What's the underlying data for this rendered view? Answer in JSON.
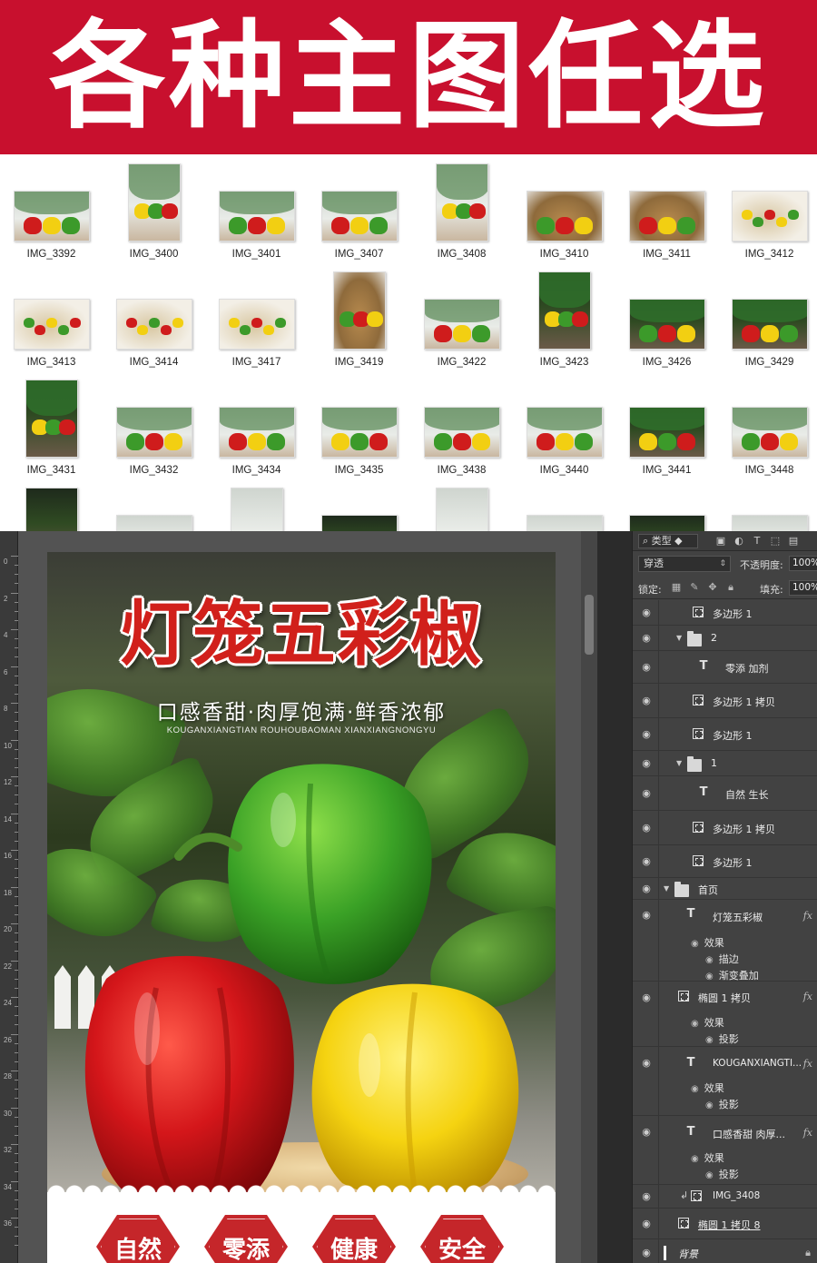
{
  "banner": {
    "title": "各种主图任选",
    "color": "#c8102e"
  },
  "thumbnails": [
    {
      "label": "IMG_3392",
      "shape": "land",
      "bg": "light"
    },
    {
      "label": "IMG_3400",
      "shape": "port",
      "bg": "light"
    },
    {
      "label": "IMG_3401",
      "shape": "land",
      "bg": "light"
    },
    {
      "label": "IMG_3407",
      "shape": "land",
      "bg": "light"
    },
    {
      "label": "IMG_3408",
      "shape": "port",
      "bg": "light"
    },
    {
      "label": "IMG_3410",
      "shape": "land",
      "bg": "basket"
    },
    {
      "label": "IMG_3411",
      "shape": "land",
      "bg": "basket"
    },
    {
      "label": "IMG_3412",
      "shape": "land",
      "bg": "plate"
    },
    {
      "label": "IMG_3413",
      "shape": "land",
      "bg": "plate"
    },
    {
      "label": "IMG_3414",
      "shape": "land",
      "bg": "plate"
    },
    {
      "label": "IMG_3417",
      "shape": "land",
      "bg": "plate"
    },
    {
      "label": "IMG_3419",
      "shape": "port",
      "bg": "basket"
    },
    {
      "label": "IMG_3422",
      "shape": "land",
      "bg": "light"
    },
    {
      "label": "IMG_3423",
      "shape": "port",
      "bg": "dark"
    },
    {
      "label": "IMG_3426",
      "shape": "land",
      "bg": "dark"
    },
    {
      "label": "IMG_3429",
      "shape": "land",
      "bg": "dark"
    },
    {
      "label": "IMG_3431",
      "shape": "port",
      "bg": "dark"
    },
    {
      "label": "IMG_3432",
      "shape": "land",
      "bg": "light"
    },
    {
      "label": "IMG_3434",
      "shape": "land",
      "bg": "light"
    },
    {
      "label": "IMG_3435",
      "shape": "land",
      "bg": "light"
    },
    {
      "label": "IMG_3438",
      "shape": "land",
      "bg": "light"
    },
    {
      "label": "IMG_3440",
      "shape": "land",
      "bg": "light"
    },
    {
      "label": "IMG_3441",
      "shape": "land",
      "bg": "dark"
    },
    {
      "label": "IMG_3448",
      "shape": "land",
      "bg": "light"
    }
  ],
  "ruler": {
    "ticks": [
      "0",
      "2",
      "4",
      "6",
      "8",
      "10",
      "12",
      "14",
      "16",
      "18",
      "20",
      "22",
      "24",
      "26",
      "28",
      "30",
      "32",
      "34",
      "36"
    ]
  },
  "poster": {
    "title": "灯笼五彩椒",
    "subtitle": "口感香甜·肉厚饱满·鲜香浓郁",
    "pinyin": "KOUGANXIANGTIAN ROUHOUBAOMAN XIANXIANGNONGYU",
    "badges": [
      "自然",
      "零添",
      "健康",
      "安全"
    ],
    "accent": "#d1201b"
  },
  "layers_panel": {
    "filter_kind": "类型",
    "blend_mode": "穿透",
    "opacity_label": "不透明度:",
    "opacity_value": "100%",
    "lock_label": "锁定:",
    "fill_label": "填充:",
    "fill_value": "100%",
    "layers": [
      {
        "name": "多边形 1",
        "type": "shape"
      },
      {
        "name": "2",
        "type": "group"
      },
      {
        "name": "零添 加剂",
        "type": "text"
      },
      {
        "name": "多边形 1 拷贝",
        "type": "shape"
      },
      {
        "name": "多边形 1",
        "type": "shape"
      },
      {
        "name": "1",
        "type": "group"
      },
      {
        "name": "自然 生长",
        "type": "text"
      },
      {
        "name": "多边形 1 拷贝",
        "type": "shape"
      },
      {
        "name": "多边形 1",
        "type": "shape"
      },
      {
        "name": "首页",
        "type": "group"
      },
      {
        "name": "灯笼五彩椒",
        "type": "text",
        "fx": "fx",
        "effects_label": "效果",
        "effects": [
          "描边",
          "渐变叠加"
        ]
      },
      {
        "name": "椭圆 1 拷贝",
        "type": "shape",
        "fx": "fx",
        "effects_label": "效果",
        "effects": [
          "投影"
        ]
      },
      {
        "name": "KOUGANXIANGTI...",
        "type": "text",
        "fx": "fx",
        "effects_label": "效果",
        "effects": [
          "投影"
        ]
      },
      {
        "name": "口感香甜 肉厚...",
        "type": "text",
        "fx": "fx",
        "effects_label": "效果",
        "effects": [
          "投影"
        ]
      },
      {
        "name": "IMG_3408",
        "type": "smart"
      },
      {
        "name": "椭圆 1 拷贝 8",
        "type": "shape"
      },
      {
        "name": "背景",
        "type": "background"
      }
    ]
  }
}
